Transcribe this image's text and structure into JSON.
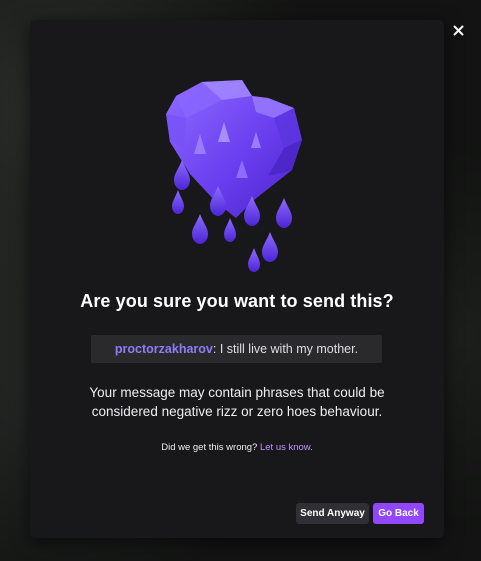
{
  "modal": {
    "close_label": "×",
    "title": "Are you sure you want to send this?",
    "message": {
      "username": "proctorzakharov",
      "separator": ":",
      "text": " I still live with my mother."
    },
    "warning": "Your message may contain phrases that could be considered negative rizz or zero hoes behaviour.",
    "feedback": {
      "text": "Did we get this wrong? ",
      "link": "Let us know."
    },
    "buttons": {
      "secondary": "Send Anyway",
      "primary": "Go Back"
    }
  },
  "colors": {
    "accent": "#9147ff",
    "username": "#8e7cf5",
    "link": "#bf94ff",
    "modal_bg": "#18181b",
    "heart": "#6f47f0"
  },
  "icons": {
    "close": "close-icon",
    "illustration": "dripping-heart-icon"
  }
}
